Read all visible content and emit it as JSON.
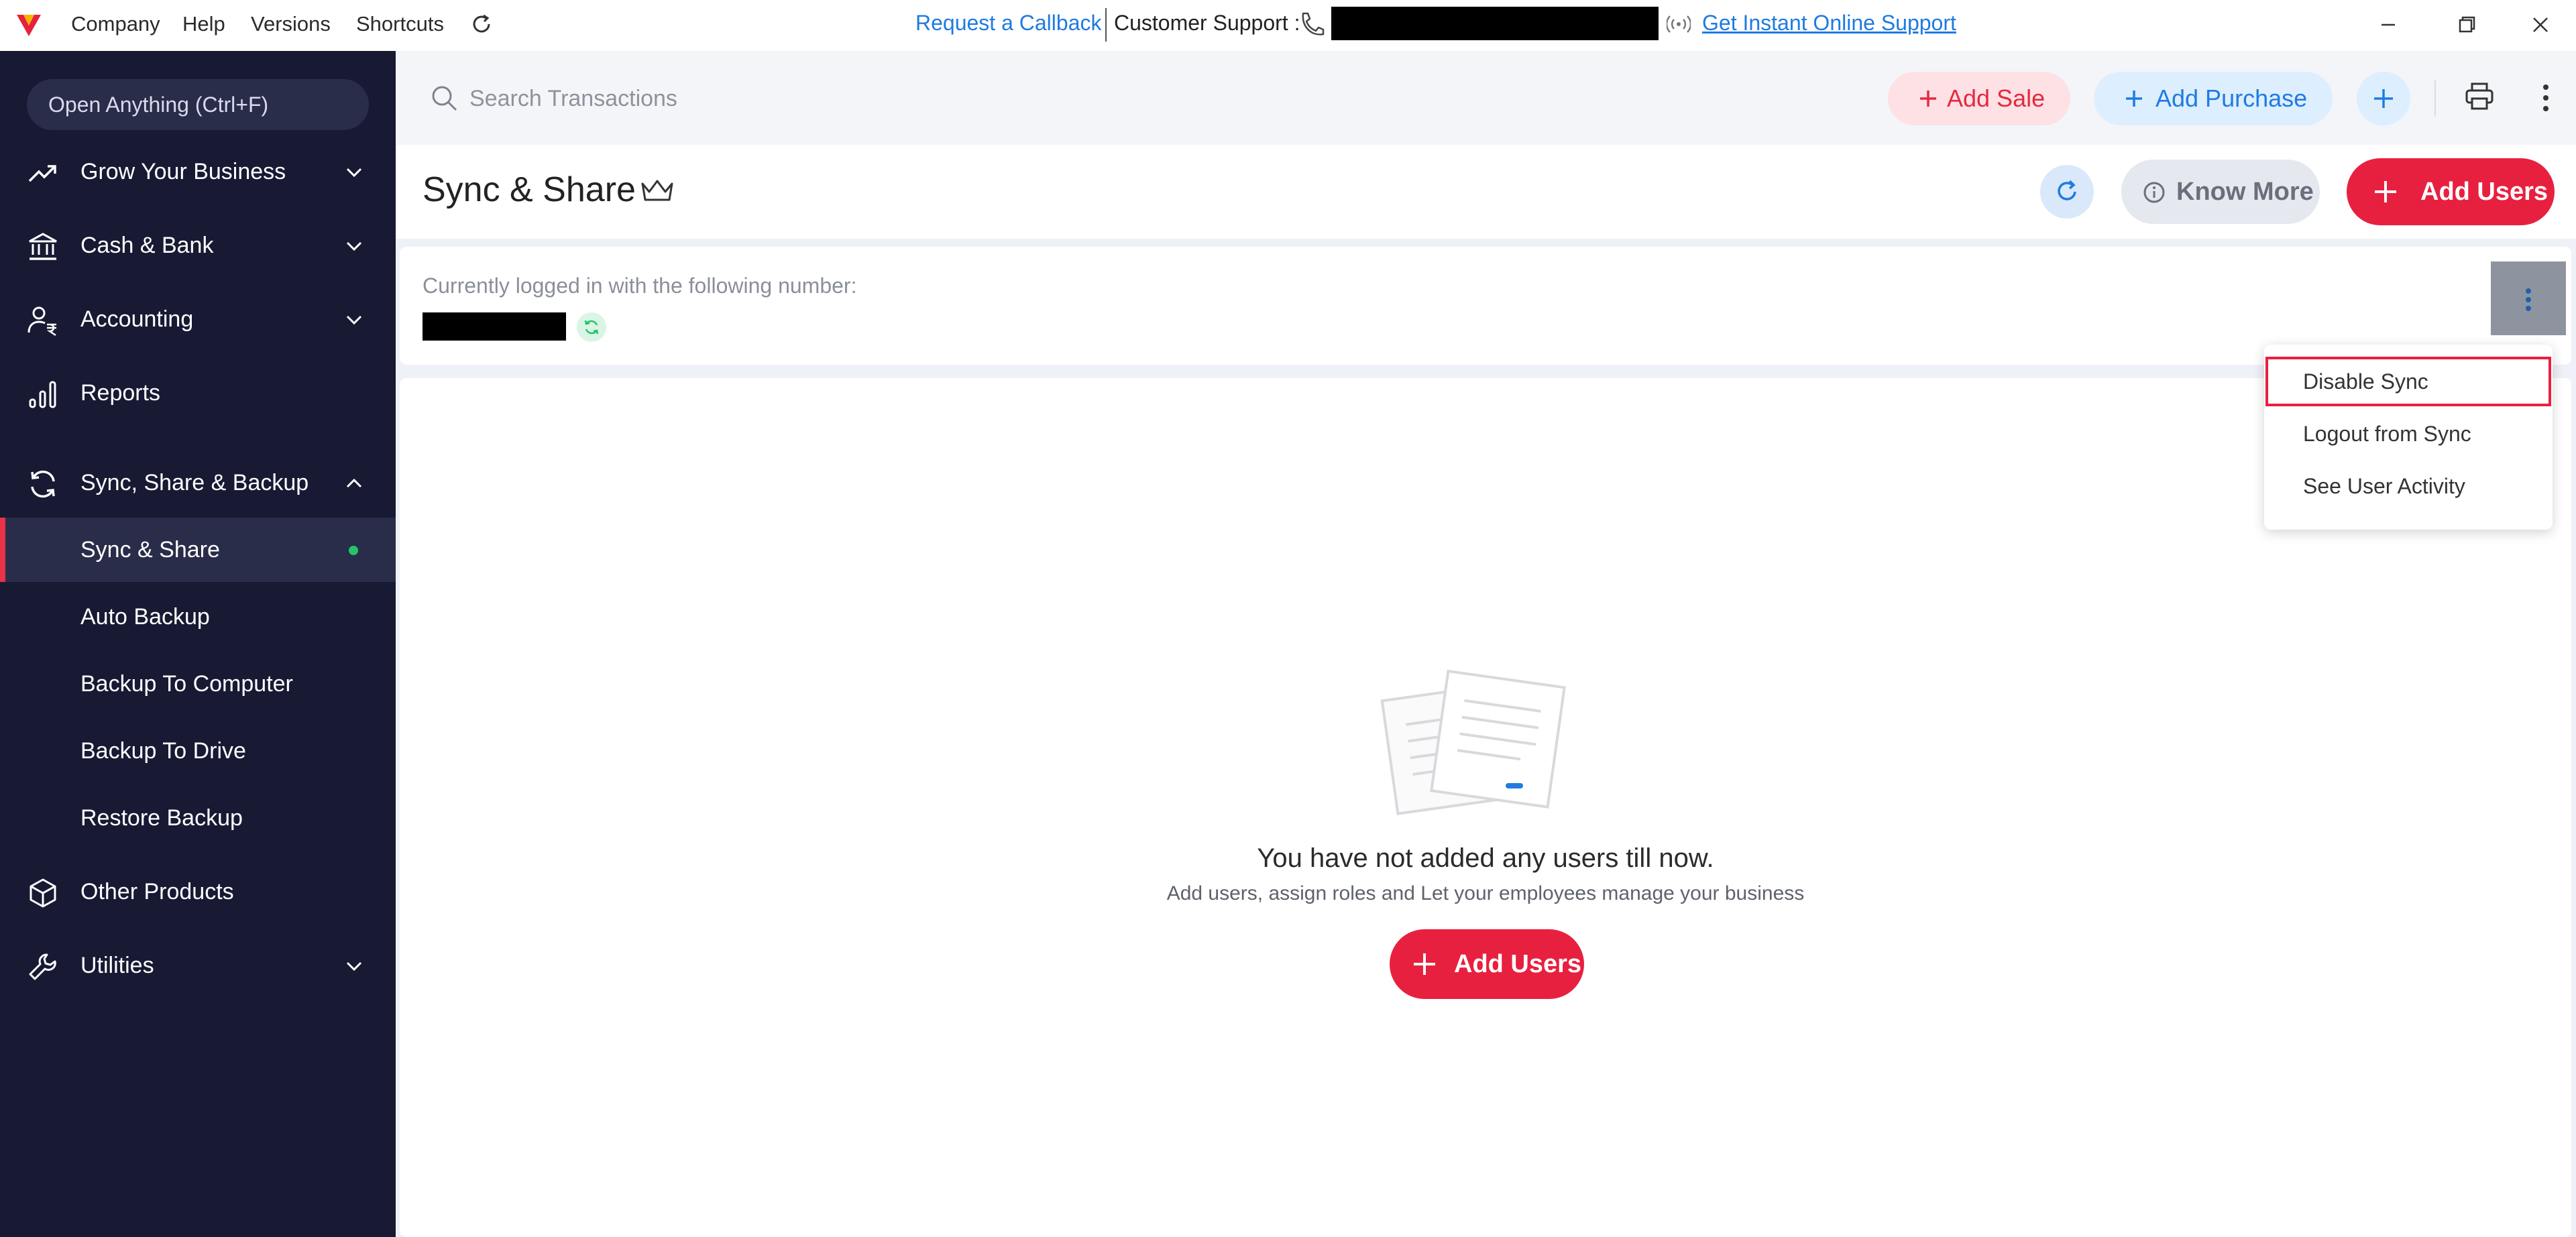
{
  "topbar": {
    "menus": [
      "Company",
      "Help",
      "Versions",
      "Shortcuts"
    ],
    "request_callback": "Request a Callback",
    "customer_support_label": "Customer Support :",
    "instant_support": "Get Instant Online Support"
  },
  "sidebar": {
    "open_anything": "Open Anything (Ctrl+F)",
    "items": [
      {
        "label": "Grow Your Business",
        "icon": "trending-up-icon"
      },
      {
        "label": "Cash & Bank",
        "icon": "bank-icon"
      },
      {
        "label": "Accounting",
        "icon": "user-rupee-icon"
      },
      {
        "label": "Reports",
        "icon": "bar-chart-icon"
      },
      {
        "label": "Sync, Share & Backup",
        "icon": "sync-icon"
      },
      {
        "label": "Other Products",
        "icon": "cube-icon"
      },
      {
        "label": "Utilities",
        "icon": "wrench-icon"
      }
    ],
    "sub_items": [
      "Sync & Share",
      "Auto Backup",
      "Backup To Computer",
      "Backup To Drive",
      "Restore Backup"
    ],
    "active_sub_item": "Sync & Share"
  },
  "toolbar": {
    "search_placeholder": "Search Transactions",
    "add_sale": "Add Sale",
    "add_purchase": "Add Purchase"
  },
  "header": {
    "title": "Sync & Share",
    "know_more": "Know More",
    "add_users": "Add Users"
  },
  "login_card": {
    "label": "Currently logged in with the following number:"
  },
  "dropdown": {
    "items": [
      "Disable Sync",
      "Logout from Sync",
      "See User Activity"
    ],
    "highlighted": "Disable Sync"
  },
  "empty_state": {
    "title": "You have not added any users till now.",
    "subtitle": "Add users, assign roles and Let your employees manage your business",
    "button": "Add Users"
  },
  "colors": {
    "sidebar_bg": "#181a34",
    "accent_red": "#e8203f",
    "accent_blue": "#1f7be0",
    "active_dot": "#27c26c"
  }
}
